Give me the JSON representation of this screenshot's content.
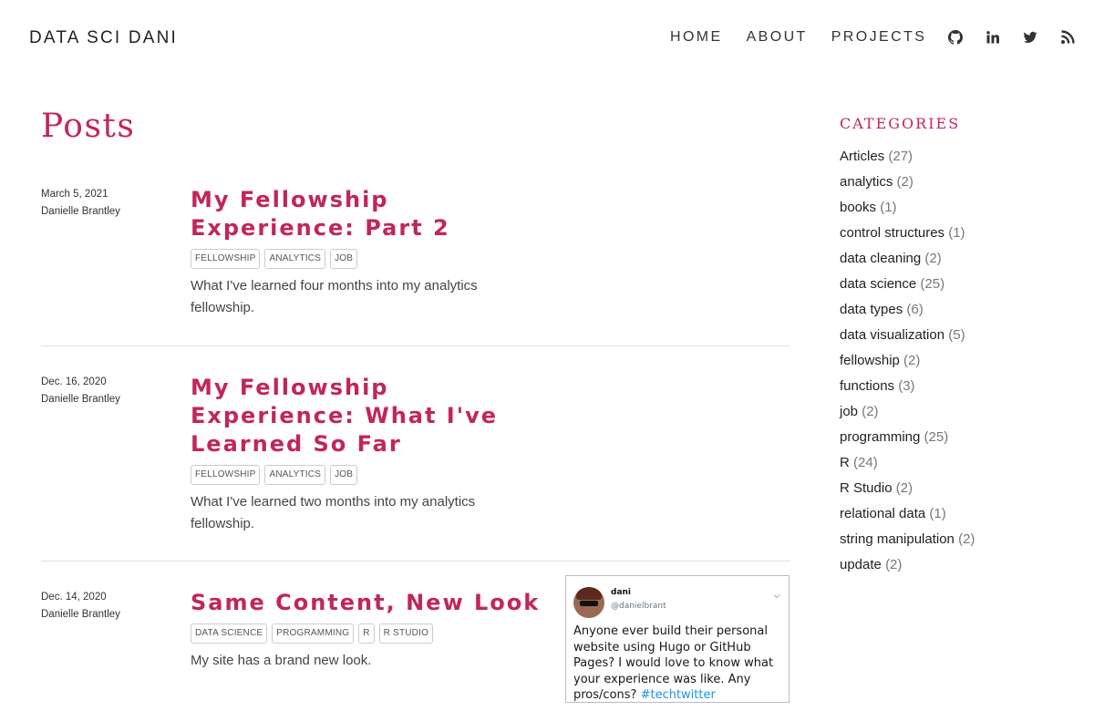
{
  "header": {
    "site_title": "DATA SCI DANI",
    "nav": [
      {
        "label": "HOME"
      },
      {
        "label": "ABOUT"
      },
      {
        "label": "PROJECTS"
      }
    ],
    "icons": [
      "github-icon",
      "linkedin-icon",
      "twitter-icon",
      "rss-icon"
    ]
  },
  "main": {
    "page_title": "Posts",
    "posts": [
      {
        "date": "March 5, 2021",
        "author": "Danielle Brantley",
        "title": "My Fellowship Experience: Part 2",
        "tags": [
          "FELLOWSHIP",
          "ANALYTICS",
          "JOB"
        ],
        "summary": "What I've learned four months into my analytics fellowship."
      },
      {
        "date": "Dec. 16, 2020",
        "author": "Danielle Brantley",
        "title": "My Fellowship Experience: What I've Learned So Far",
        "tags": [
          "FELLOWSHIP",
          "ANALYTICS",
          "JOB"
        ],
        "summary": "What I've learned two months into my analytics fellowship."
      },
      {
        "date": "Dec. 14, 2020",
        "author": "Danielle Brantley",
        "title": "Same Content, New Look",
        "tags": [
          "DATA SCIENCE",
          "PROGRAMMING",
          "R",
          "R STUDIO"
        ],
        "summary": "My site has a brand new look.",
        "image": {
          "name": "dani",
          "handle": "@danielbrant",
          "text": "Anyone ever build their personal website using Hugo or GitHub Pages? I would love to know what your experience was like. Any pros/cons?",
          "hashtag": "#techtwitter"
        }
      }
    ]
  },
  "sidebar": {
    "heading": "CATEGORIES",
    "categories": [
      {
        "name": "Articles",
        "count": "(27)"
      },
      {
        "name": "analytics",
        "count": "(2)"
      },
      {
        "name": "books",
        "count": "(1)"
      },
      {
        "name": "control structures",
        "count": "(1)"
      },
      {
        "name": "data cleaning",
        "count": "(2)"
      },
      {
        "name": "data science",
        "count": "(25)"
      },
      {
        "name": "data types",
        "count": "(6)"
      },
      {
        "name": "data visualization",
        "count": "(5)"
      },
      {
        "name": "fellowship",
        "count": "(2)"
      },
      {
        "name": "functions",
        "count": "(3)"
      },
      {
        "name": "job",
        "count": "(2)"
      },
      {
        "name": "programming",
        "count": "(25)"
      },
      {
        "name": "R",
        "count": "(24)"
      },
      {
        "name": "R Studio",
        "count": "(2)"
      },
      {
        "name": "relational data",
        "count": "(1)"
      },
      {
        "name": "string manipulation",
        "count": "(2)"
      },
      {
        "name": "update",
        "count": "(2)"
      }
    ]
  },
  "colors": {
    "accent": "#c2255c",
    "text": "#333333",
    "hashtag": "#1b95e0"
  }
}
